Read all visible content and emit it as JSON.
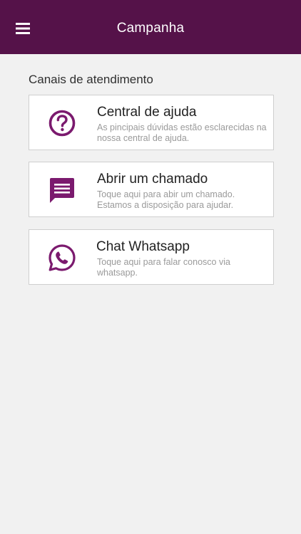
{
  "header": {
    "title": "Campanha",
    "menu_icon": "hamburger-menu-icon",
    "background_color": "#551249"
  },
  "section": {
    "title": "Canais de atendimento"
  },
  "accent_color": "#7b1a6e",
  "channels": [
    {
      "title": "Central de ajuda",
      "description": "As pincipais dúvidas estão esclarecidas na nossa central de ajuda.",
      "icon": "help-circle-icon"
    },
    {
      "title": "Abrir um chamado",
      "description": "Toque aqui para abir um chamado. Estamos a disposição para ajudar.",
      "icon": "message-icon"
    },
    {
      "title": "Chat Whatsapp",
      "description": "Toque aqui para falar conosco via whatsapp.",
      "icon": "whatsapp-icon"
    }
  ]
}
